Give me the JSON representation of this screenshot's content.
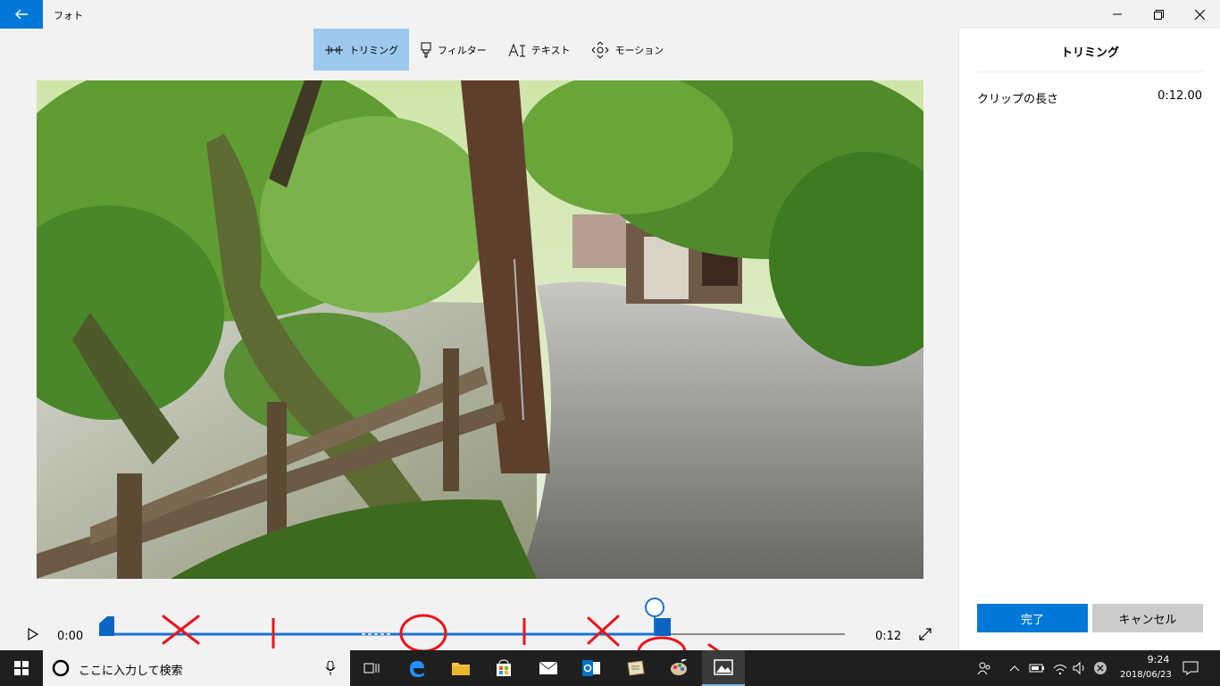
{
  "window": {
    "title": "フォト"
  },
  "toolbar": {
    "items": [
      {
        "label": "トリミング",
        "icon": "trim-icon",
        "active": true
      },
      {
        "label": "フィルター",
        "icon": "filter-icon",
        "active": false
      },
      {
        "label": "テキスト",
        "icon": "text-icon",
        "active": false
      },
      {
        "label": "モーション",
        "icon": "motion-icon",
        "active": false
      }
    ]
  },
  "playback": {
    "time_start": "0:00",
    "time_end": "0:12",
    "trim_end_fraction": 0.74,
    "playhead_fraction": 0.74
  },
  "panel": {
    "title": "トリミング",
    "clip_length_label": "クリップの長さ",
    "clip_length_value": "0:12.00",
    "done_label": "完了",
    "cancel_label": "キャンセル"
  },
  "taskbar": {
    "search_placeholder": "ここに入力して検索",
    "clock_time": "9:24",
    "clock_date": "2018/06/23"
  },
  "colors": {
    "accent": "#0078d7",
    "annotation": "#e8141c",
    "active_tab": "#9ec9ee"
  }
}
